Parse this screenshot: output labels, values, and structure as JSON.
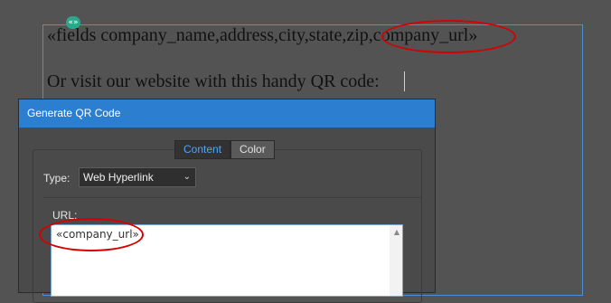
{
  "document": {
    "frame_tag": "«»",
    "line1": "«fields company_name,address,city,state,zip,company_url»",
    "line2": "Or visit our website with this handy QR code:"
  },
  "dialog": {
    "title": "Generate QR Code",
    "tabs": [
      {
        "label": "Content",
        "active": true
      },
      {
        "label": "Color",
        "active": false
      }
    ],
    "type_label": "Type:",
    "type_value": "Web Hyperlink",
    "url_label": "URL:",
    "url_value": "«company_url»"
  },
  "colors": {
    "titlebar": "#2c7fd0",
    "annotation_ellipse": "#d50000",
    "frame_border": "#4a90d9"
  }
}
